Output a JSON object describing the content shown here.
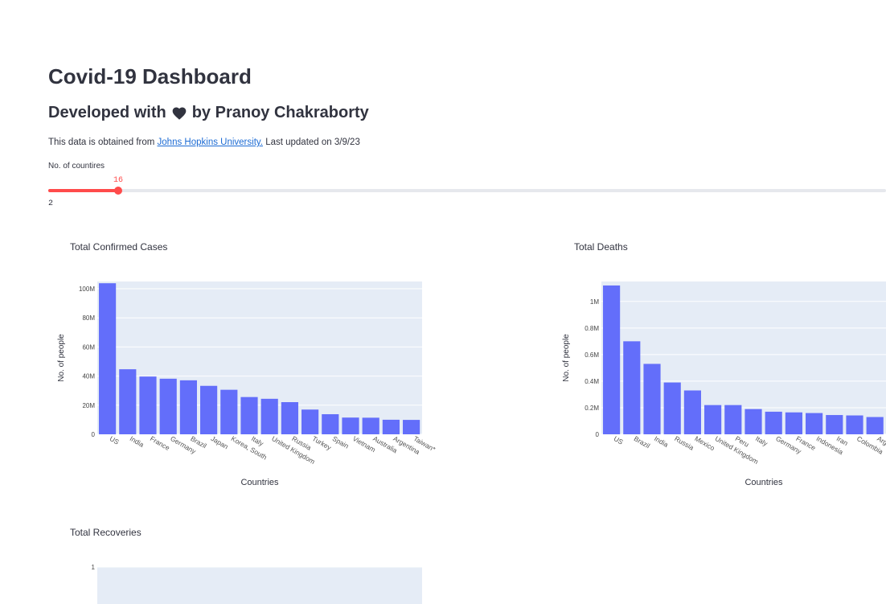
{
  "header": {
    "title": "Covid-19 Dashboard",
    "subtitle_prefix": "Developed with",
    "subtitle_suffix": "by Pranoy Chakraborty",
    "source_prefix": "This data is obtained from",
    "source_link": "Johns Hopkins University.",
    "source_suffix": "Last updated on 3/9/23"
  },
  "slider": {
    "label": "No. of countires",
    "value": 16,
    "min_label": "2",
    "accent_color": "#ff4b4b"
  },
  "colors": {
    "bar": "#636efa",
    "plot_bg": "#e5ecf6",
    "text": "#31333f"
  },
  "chart_data": [
    {
      "type": "bar",
      "title": "Total Confirmed Cases",
      "xlabel": "Countries",
      "ylabel": "No. of people",
      "categories": [
        "US",
        "India",
        "France",
        "Germany",
        "Brazil",
        "Japan",
        "Korea, South",
        "Italy",
        "United Kingdom",
        "Russia",
        "Turkey",
        "Spain",
        "Vietnam",
        "Australia",
        "Argentina",
        "Taiwan*"
      ],
      "values": [
        103.8,
        44.7,
        39.7,
        38.2,
        37.1,
        33.3,
        30.6,
        25.6,
        24.4,
        22.1,
        17.0,
        13.8,
        11.5,
        11.4,
        10.0,
        9.9
      ],
      "unit": "M",
      "yticks": [
        "0",
        "20M",
        "40M",
        "60M",
        "80M",
        "100M"
      ],
      "ylim": [
        0,
        105
      ],
      "grid": true
    },
    {
      "type": "bar",
      "title": "Total Deaths",
      "xlabel": "Countries",
      "ylabel": "No. of people",
      "categories": [
        "US",
        "Brazil",
        "India",
        "Russia",
        "Mexico",
        "United Kingdom",
        "Peru",
        "Italy",
        "Germany",
        "France",
        "Indonesia",
        "Iran",
        "Colombia",
        "Arge"
      ],
      "values": [
        1.12,
        0.7,
        0.53,
        0.39,
        0.33,
        0.22,
        0.22,
        0.19,
        0.17,
        0.165,
        0.16,
        0.145,
        0.142,
        0.13
      ],
      "unit": "M",
      "yticks": [
        "0",
        "0.2M",
        "0.4M",
        "0.6M",
        "0.8M",
        "1M"
      ],
      "ylim": [
        0,
        1.15
      ],
      "grid": true
    },
    {
      "type": "bar",
      "title": "Total Recoveries",
      "xlabel": "",
      "ylabel": "",
      "categories": [],
      "values": [],
      "yticks": [
        "1"
      ],
      "ylim": [
        0,
        1
      ],
      "grid": true
    }
  ]
}
